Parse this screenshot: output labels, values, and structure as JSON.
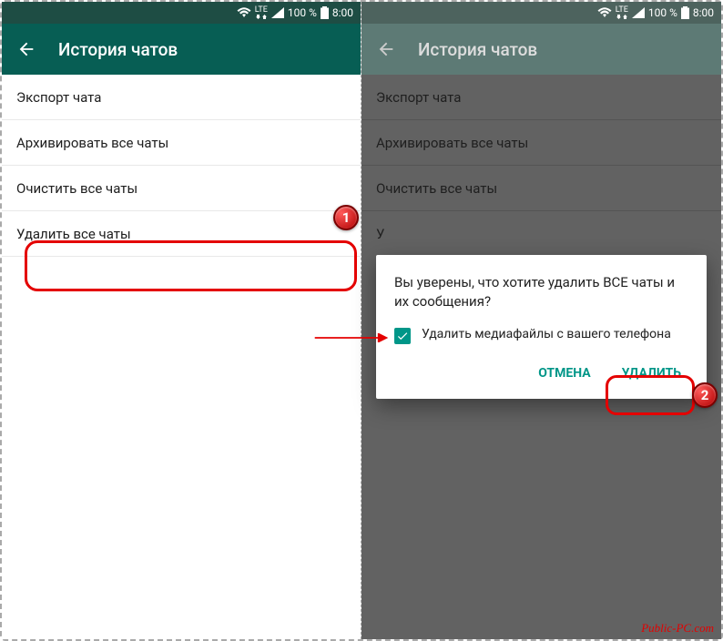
{
  "statusbar": {
    "network": "LTE",
    "battery": "100 %",
    "time": "8:00"
  },
  "appbar": {
    "title": "История чатов"
  },
  "menu": {
    "export": "Экспорт чата",
    "archive": "Архивировать все чаты",
    "clear": "Очистить все чаты",
    "delete": "Удалить все чаты"
  },
  "dialog": {
    "message": "Вы уверены, что хотите удалить ВСЕ чаты и их сообщения?",
    "checkbox_label": "Удалить медиафайлы с вашего телефона",
    "cancel": "ОТМЕНА",
    "confirm": "УДАЛИТЬ"
  },
  "annotations": {
    "badge1": "1",
    "badge2": "2"
  },
  "watermark": "Public-PC.com"
}
